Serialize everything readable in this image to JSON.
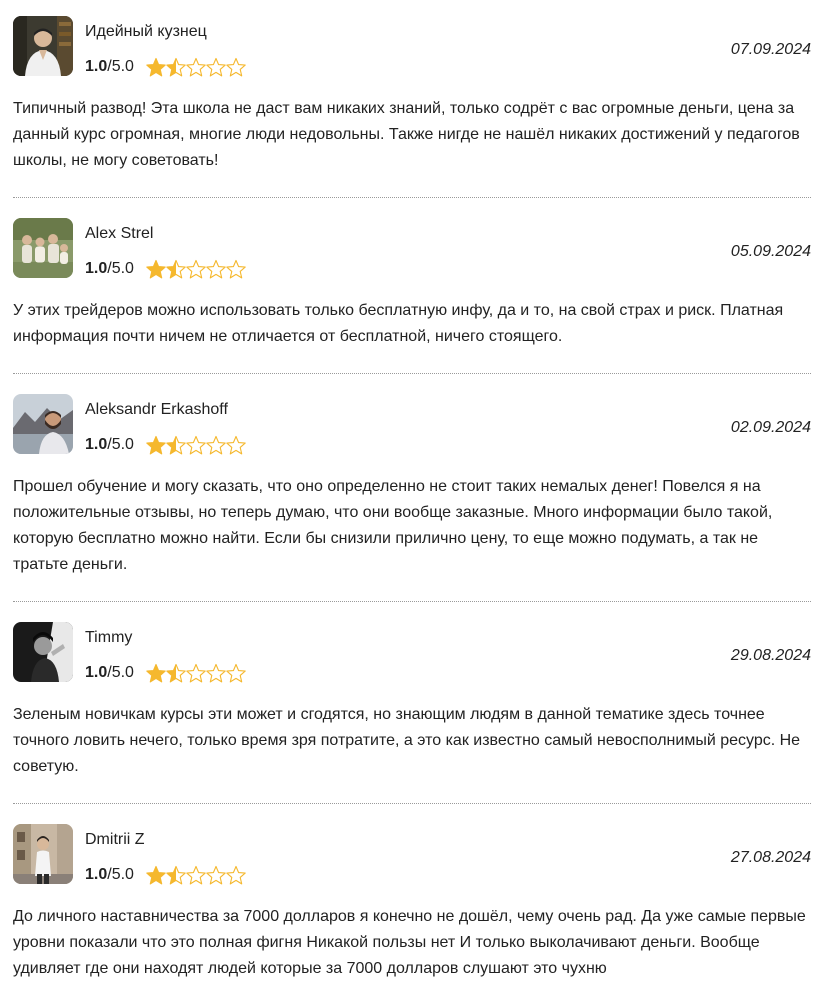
{
  "reviews": [
    {
      "author": "Идейный кузнец",
      "score": "1.0",
      "max": "/5.0",
      "stars": 1.5,
      "date": "07.09.2024",
      "text": "Типичный развод! Эта школа не даст вам никаких знаний, только содрёт с вас огромные деньги, цена за данный курс огромная, многие люди недовольны. Также нигде не нашёл никаких достижений у педагогов школы, не могу советовать!",
      "avatar": "person-portrait-bookshelf"
    },
    {
      "author": "Alex Strel",
      "score": "1.0",
      "max": "/5.0",
      "stars": 1.5,
      "date": "05.09.2024",
      "text": "У этих трейдеров можно использовать только бесплатную инфу, да и то, на свой страх и риск. Платная информация почти ничем не отличается от бесплатной, ничего стоящего.",
      "avatar": "family-outdoor"
    },
    {
      "author": "Aleksandr Erkashoff",
      "score": "1.0",
      "max": "/5.0",
      "stars": 1.5,
      "date": "02.09.2024",
      "text": "Прошел обучение и могу сказать, что оно определенно не стоит таких немалых денег! Повелся я на положительные отзывы, но теперь думаю, что они вообще заказные. Много информации было такой, которую бесплатно можно найти. Если бы снизили прилично цену, то еще можно подумать, а так не тратьте деньги.",
      "avatar": "person-mountains"
    },
    {
      "author": "Timmy",
      "score": "1.0",
      "max": "/5.0",
      "stars": 1.5,
      "date": "29.08.2024",
      "text": "Зеленым новичкам курсы эти может и сгодятся, но знающим людям в данной тематике здесь точнее точного ловить нечего, только время зря потратите, а это как известно самый невосполнимый ресурс. Не советую.",
      "avatar": "person-dark-bw"
    },
    {
      "author": "Dmitrii Z",
      "score": "1.0",
      "max": "/5.0",
      "stars": 1.5,
      "date": "27.08.2024",
      "text": "До личного наставничества за 7000 долларов я конечно не дошёл, чему очень рад. Да уже самые первые уровни показали что это полная фигня Никакой пользы нет И только выколачивают деньги. Вообще удивляет где они находят людей которые за 7000 долларов слушают это чухню",
      "avatar": "person-street"
    }
  ],
  "colors": {
    "star": "#f5b82e",
    "separator": "#9a9a9a",
    "text": "#222222"
  }
}
